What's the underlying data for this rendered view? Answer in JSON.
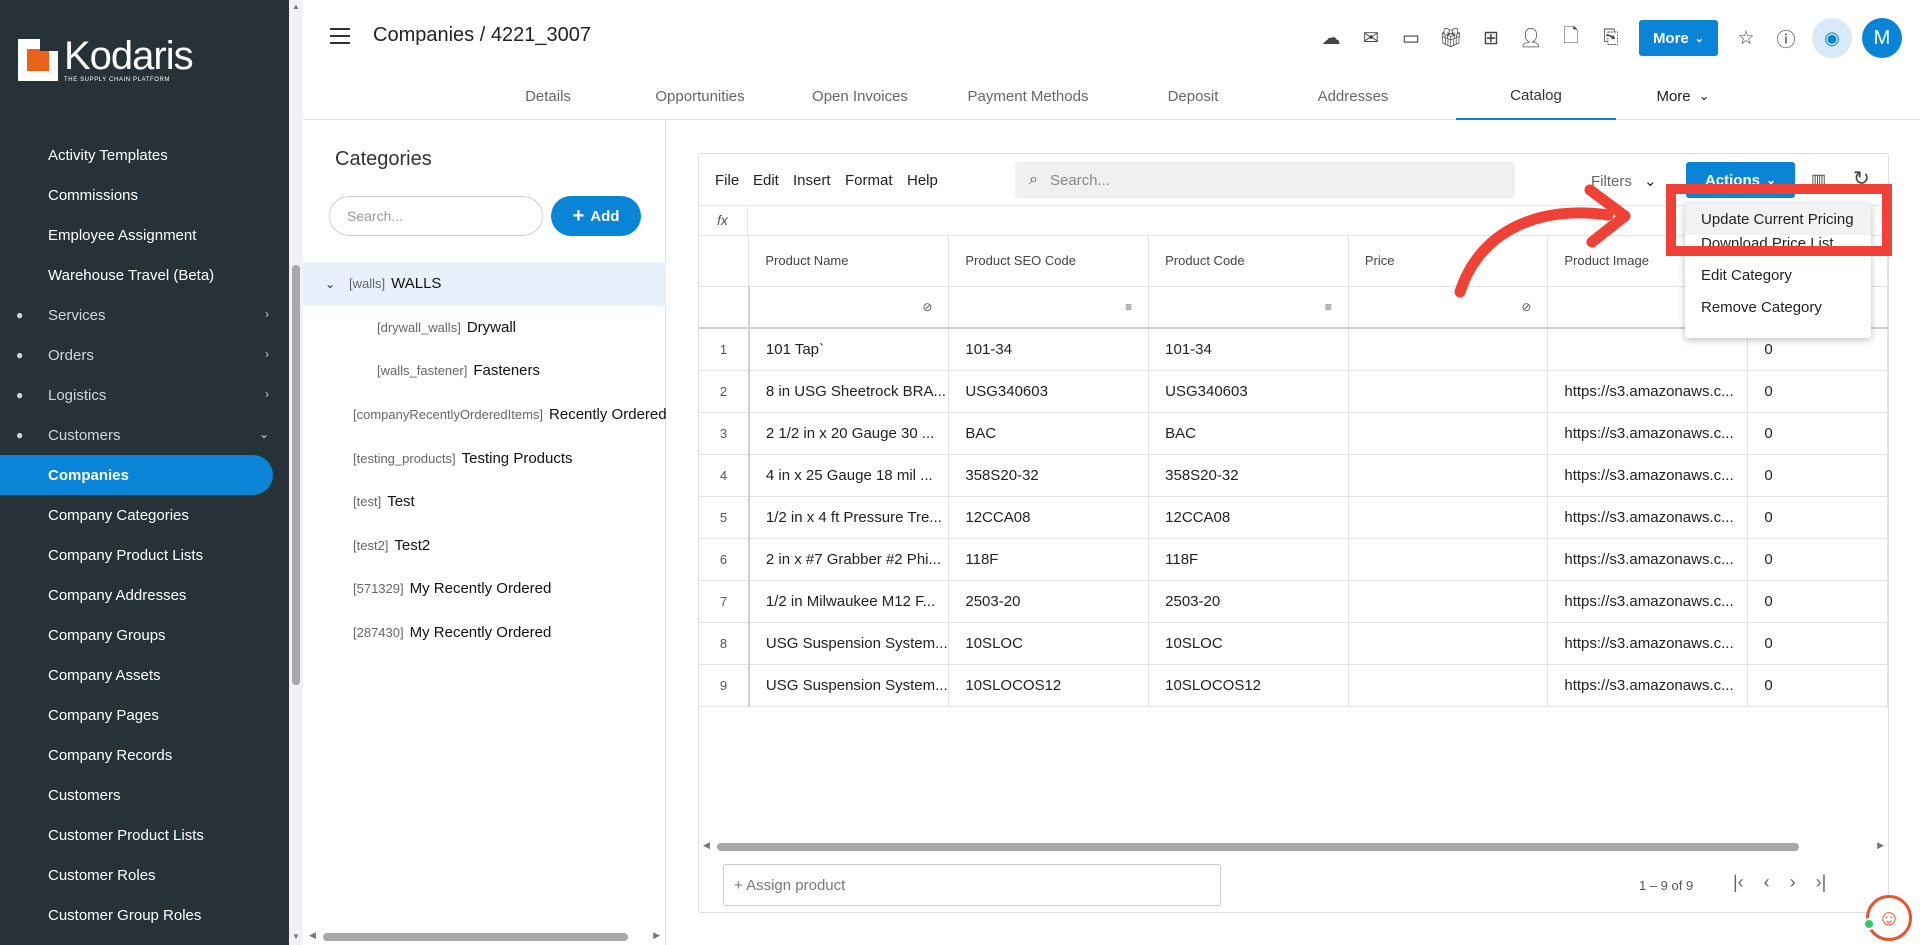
{
  "brand": {
    "name": "Kodaris",
    "tagline": "THE SUPPLY CHAIN PLATFORM"
  },
  "sidebar": {
    "items": [
      {
        "label": "Activity Templates",
        "type": "link"
      },
      {
        "label": "Commissions",
        "type": "link"
      },
      {
        "label": "Employee Assignment",
        "type": "link"
      },
      {
        "label": "Warehouse Travel (Beta)",
        "type": "link"
      },
      {
        "label": "Services",
        "type": "group",
        "icon": "gears-icon",
        "chevron": "›"
      },
      {
        "label": "Orders",
        "type": "group",
        "icon": "truck-icon",
        "chevron": "›"
      },
      {
        "label": "Logistics",
        "type": "group",
        "icon": "van-icon",
        "chevron": "›"
      },
      {
        "label": "Customers",
        "type": "group",
        "icon": "people-icon",
        "chevron": "⌄"
      },
      {
        "label": "Companies",
        "type": "link",
        "active": true
      },
      {
        "label": "Company Categories",
        "type": "link"
      },
      {
        "label": "Company Product Lists",
        "type": "link"
      },
      {
        "label": "Company Addresses",
        "type": "link"
      },
      {
        "label": "Company Groups",
        "type": "link"
      },
      {
        "label": "Company Assets",
        "type": "link"
      },
      {
        "label": "Company Pages",
        "type": "link"
      },
      {
        "label": "Company Records",
        "type": "link"
      },
      {
        "label": "Customers",
        "type": "link"
      },
      {
        "label": "Customer Product Lists",
        "type": "link"
      },
      {
        "label": "Customer Roles",
        "type": "link"
      },
      {
        "label": "Customer Group Roles",
        "type": "link"
      }
    ]
  },
  "header": {
    "title": "Companies / 4221_3007",
    "more_label": "More",
    "avatar_letter": "M",
    "icons": [
      "cloud-upload-icon",
      "mail-icon",
      "payment-card-icon",
      "gift-icon",
      "monitor-plus-icon",
      "add-person-icon",
      "add-document-icon",
      "attachment-icon"
    ]
  },
  "tabs": [
    {
      "label": "Details"
    },
    {
      "label": "Opportunities"
    },
    {
      "label": "Open Invoices"
    },
    {
      "label": "Payment Methods"
    },
    {
      "label": "Deposit"
    },
    {
      "label": "Addresses"
    },
    {
      "label": "Catalog",
      "active": true
    },
    {
      "label": "More"
    }
  ],
  "categories": {
    "title": "Categories",
    "search_placeholder": "Search...",
    "add_label": "Add",
    "items": [
      {
        "code": "[walls]",
        "name": "WALLS",
        "level": 0,
        "expanded": true,
        "selected": true
      },
      {
        "code": "[drywall_walls]",
        "name": "Drywall",
        "level": 1
      },
      {
        "code": "[walls_fastener]",
        "name": "Fasteners",
        "level": 1
      },
      {
        "code": "[companyRecentlyOrderedItems]",
        "name": "Recently Ordered",
        "level": 0
      },
      {
        "code": "[testing_products]",
        "name": "Testing Products",
        "level": 0
      },
      {
        "code": "[test]",
        "name": "Test",
        "level": 0
      },
      {
        "code": "[test2]",
        "name": "Test2",
        "level": 0
      },
      {
        "code": "[571329]",
        "name": "My Recently Ordered",
        "level": 0
      },
      {
        "code": "[287430]",
        "name": "My Recently Ordered",
        "level": 0
      }
    ]
  },
  "grid": {
    "menu": [
      "File",
      "Edit",
      "Insert",
      "Format",
      "Help"
    ],
    "search_placeholder": "Search...",
    "filters_label": "Filters",
    "actions_label": "Actions",
    "fx_label": "fx",
    "columns": [
      "Product Name",
      "Product SEO Code",
      "Product Code",
      "Price",
      "Product Image",
      ""
    ],
    "rows": [
      [
        "1",
        "101 Tap`",
        "101-34",
        "101-34",
        "",
        "",
        "0"
      ],
      [
        "2",
        "8 in USG Sheetrock BRA...",
        "USG340603",
        "USG340603",
        "",
        "https://s3.amazonaws.c...",
        "0"
      ],
      [
        "3",
        "2 1/2 in x 20 Gauge 30 ...",
        "BAC",
        "BAC",
        "",
        "https://s3.amazonaws.c...",
        "0"
      ],
      [
        "4",
        "4 in x 25 Gauge 18 mil ...",
        "358S20-32",
        "358S20-32",
        "",
        "https://s3.amazonaws.c...",
        "0"
      ],
      [
        "5",
        "1/2 in x 4 ft Pressure Tre...",
        "12CCA08",
        "12CCA08",
        "",
        "https://s3.amazonaws.c...",
        "0"
      ],
      [
        "6",
        "2 in x #7 Grabber #2 Phi...",
        "118F",
        "118F",
        "",
        "https://s3.amazonaws.c...",
        "0"
      ],
      [
        "7",
        "1/2 in Milwaukee M12 F...",
        "2503-20",
        "2503-20",
        "",
        "https://s3.amazonaws.c...",
        "0"
      ],
      [
        "8",
        "USG Suspension System...",
        "10SLOC",
        "10SLOC",
        "",
        "https://s3.amazonaws.c...",
        "0"
      ],
      [
        "9",
        "USG Suspension System...",
        "10SLOCOS12",
        "10SLOCOS12",
        "",
        "https://s3.amazonaws.c...",
        "0"
      ]
    ],
    "assign_placeholder": "+ Assign product",
    "pager_text": "1 – 9 of 9"
  },
  "actions_menu": {
    "items": [
      "Update Current Pricing",
      "Download Price List",
      "Edit Category",
      "Remove Category"
    ]
  },
  "colors": {
    "accent": "#0a84d6",
    "sidebar_bg": "#263238",
    "highlight": "#f04136"
  }
}
